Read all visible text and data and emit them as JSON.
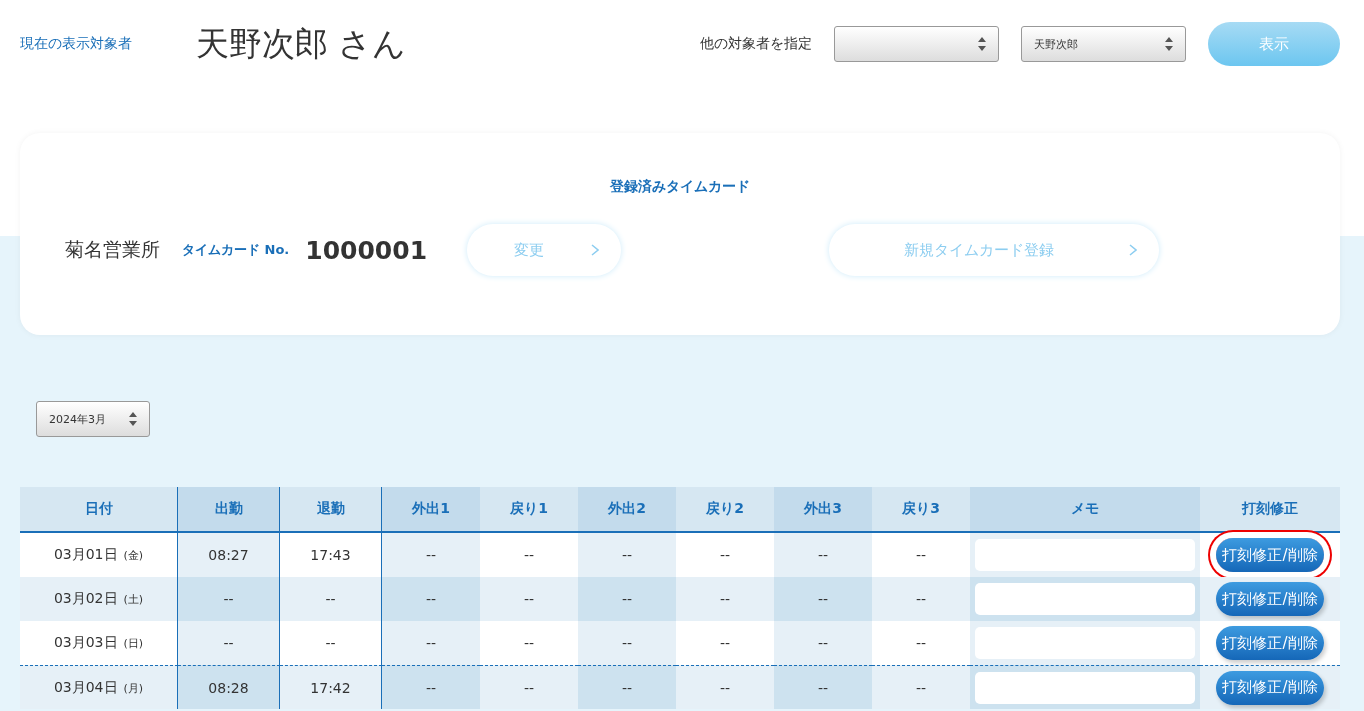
{
  "header": {
    "label": "現在の表示対象者",
    "person_name": "天野次郎 さん",
    "other_label": "他の対象者を指定",
    "select_2": {
      "value": "天野次郎"
    },
    "show_button": "表示"
  },
  "timecard": {
    "title": "登録済みタイムカード",
    "office": "菊名営業所",
    "no_label": "タイムカード No.",
    "number": "1000001",
    "change_button": "変更",
    "new_button": "新規タイムカード登録"
  },
  "month_select": {
    "value": "2024年3月"
  },
  "table": {
    "columns": [
      "日付",
      "出勤",
      "退勤",
      "外出1",
      "戻り1",
      "外出2",
      "戻り2",
      "外出3",
      "戻り3",
      "メモ",
      "打刻修正"
    ],
    "rows": [
      {
        "cells": [
          "03月01日",
          "08:27",
          "17:43",
          "--",
          "--",
          "--",
          "--",
          "--",
          "--"
        ],
        "weekday": "(金)",
        "action": "打刻修正/削除",
        "highlighted": true,
        "week_start": false
      },
      {
        "cells": [
          "03月02日",
          "--",
          "--",
          "--",
          "--",
          "--",
          "--",
          "--",
          "--"
        ],
        "weekday": "(土)",
        "action": "打刻修正/削除",
        "highlighted": false,
        "week_start": false
      },
      {
        "cells": [
          "03月03日",
          "--",
          "--",
          "--",
          "--",
          "--",
          "--",
          "--",
          "--"
        ],
        "weekday": "(日)",
        "action": "打刻修正/削除",
        "highlighted": false,
        "week_start": false
      },
      {
        "cells": [
          "03月04日",
          "08:28",
          "17:42",
          "--",
          "--",
          "--",
          "--",
          "--",
          "--"
        ],
        "weekday": "(月)",
        "action": "打刻修正/削除",
        "highlighted": false,
        "week_start": true
      }
    ]
  }
}
